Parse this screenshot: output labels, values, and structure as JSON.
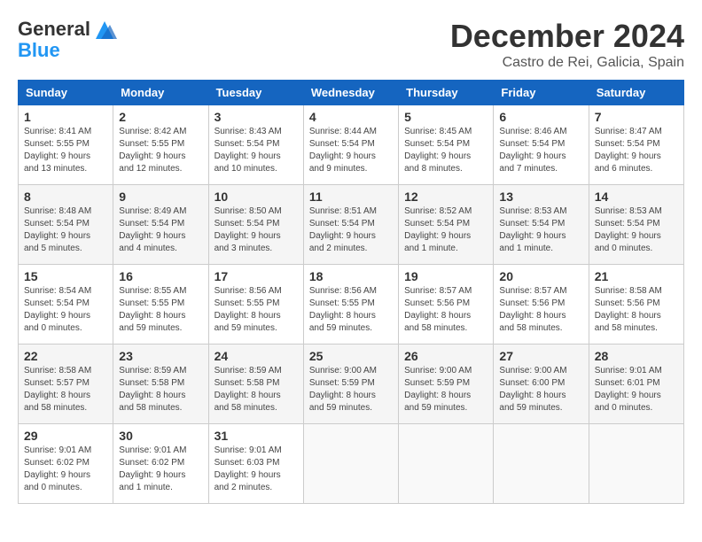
{
  "logo": {
    "line1": "General",
    "line2": "Blue"
  },
  "title": "December 2024",
  "location": "Castro de Rei, Galicia, Spain",
  "weekdays": [
    "Sunday",
    "Monday",
    "Tuesday",
    "Wednesday",
    "Thursday",
    "Friday",
    "Saturday"
  ],
  "weeks": [
    [
      {
        "day": "1",
        "info": "Sunrise: 8:41 AM\nSunset: 5:55 PM\nDaylight: 9 hours and 13 minutes."
      },
      {
        "day": "2",
        "info": "Sunrise: 8:42 AM\nSunset: 5:55 PM\nDaylight: 9 hours and 12 minutes."
      },
      {
        "day": "3",
        "info": "Sunrise: 8:43 AM\nSunset: 5:54 PM\nDaylight: 9 hours and 10 minutes."
      },
      {
        "day": "4",
        "info": "Sunrise: 8:44 AM\nSunset: 5:54 PM\nDaylight: 9 hours and 9 minutes."
      },
      {
        "day": "5",
        "info": "Sunrise: 8:45 AM\nSunset: 5:54 PM\nDaylight: 9 hours and 8 minutes."
      },
      {
        "day": "6",
        "info": "Sunrise: 8:46 AM\nSunset: 5:54 PM\nDaylight: 9 hours and 7 minutes."
      },
      {
        "day": "7",
        "info": "Sunrise: 8:47 AM\nSunset: 5:54 PM\nDaylight: 9 hours and 6 minutes."
      }
    ],
    [
      {
        "day": "8",
        "info": "Sunrise: 8:48 AM\nSunset: 5:54 PM\nDaylight: 9 hours and 5 minutes."
      },
      {
        "day": "9",
        "info": "Sunrise: 8:49 AM\nSunset: 5:54 PM\nDaylight: 9 hours and 4 minutes."
      },
      {
        "day": "10",
        "info": "Sunrise: 8:50 AM\nSunset: 5:54 PM\nDaylight: 9 hours and 3 minutes."
      },
      {
        "day": "11",
        "info": "Sunrise: 8:51 AM\nSunset: 5:54 PM\nDaylight: 9 hours and 2 minutes."
      },
      {
        "day": "12",
        "info": "Sunrise: 8:52 AM\nSunset: 5:54 PM\nDaylight: 9 hours and 1 minute."
      },
      {
        "day": "13",
        "info": "Sunrise: 8:53 AM\nSunset: 5:54 PM\nDaylight: 9 hours and 1 minute."
      },
      {
        "day": "14",
        "info": "Sunrise: 8:53 AM\nSunset: 5:54 PM\nDaylight: 9 hours and 0 minutes."
      }
    ],
    [
      {
        "day": "15",
        "info": "Sunrise: 8:54 AM\nSunset: 5:54 PM\nDaylight: 9 hours and 0 minutes."
      },
      {
        "day": "16",
        "info": "Sunrise: 8:55 AM\nSunset: 5:55 PM\nDaylight: 8 hours and 59 minutes."
      },
      {
        "day": "17",
        "info": "Sunrise: 8:56 AM\nSunset: 5:55 PM\nDaylight: 8 hours and 59 minutes."
      },
      {
        "day": "18",
        "info": "Sunrise: 8:56 AM\nSunset: 5:55 PM\nDaylight: 8 hours and 59 minutes."
      },
      {
        "day": "19",
        "info": "Sunrise: 8:57 AM\nSunset: 5:56 PM\nDaylight: 8 hours and 58 minutes."
      },
      {
        "day": "20",
        "info": "Sunrise: 8:57 AM\nSunset: 5:56 PM\nDaylight: 8 hours and 58 minutes."
      },
      {
        "day": "21",
        "info": "Sunrise: 8:58 AM\nSunset: 5:56 PM\nDaylight: 8 hours and 58 minutes."
      }
    ],
    [
      {
        "day": "22",
        "info": "Sunrise: 8:58 AM\nSunset: 5:57 PM\nDaylight: 8 hours and 58 minutes."
      },
      {
        "day": "23",
        "info": "Sunrise: 8:59 AM\nSunset: 5:58 PM\nDaylight: 8 hours and 58 minutes."
      },
      {
        "day": "24",
        "info": "Sunrise: 8:59 AM\nSunset: 5:58 PM\nDaylight: 8 hours and 58 minutes."
      },
      {
        "day": "25",
        "info": "Sunrise: 9:00 AM\nSunset: 5:59 PM\nDaylight: 8 hours and 59 minutes."
      },
      {
        "day": "26",
        "info": "Sunrise: 9:00 AM\nSunset: 5:59 PM\nDaylight: 8 hours and 59 minutes."
      },
      {
        "day": "27",
        "info": "Sunrise: 9:00 AM\nSunset: 6:00 PM\nDaylight: 8 hours and 59 minutes."
      },
      {
        "day": "28",
        "info": "Sunrise: 9:01 AM\nSunset: 6:01 PM\nDaylight: 9 hours and 0 minutes."
      }
    ],
    [
      {
        "day": "29",
        "info": "Sunrise: 9:01 AM\nSunset: 6:02 PM\nDaylight: 9 hours and 0 minutes."
      },
      {
        "day": "30",
        "info": "Sunrise: 9:01 AM\nSunset: 6:02 PM\nDaylight: 9 hours and 1 minute."
      },
      {
        "day": "31",
        "info": "Sunrise: 9:01 AM\nSunset: 6:03 PM\nDaylight: 9 hours and 2 minutes."
      },
      null,
      null,
      null,
      null
    ]
  ]
}
